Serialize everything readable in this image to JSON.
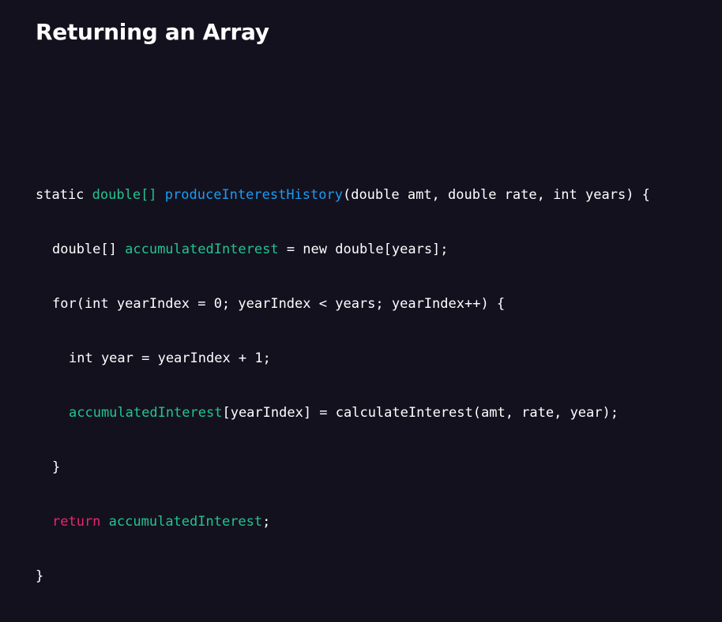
{
  "slide": {
    "title": "Returning an Array"
  },
  "colors": {
    "background": "#14111f",
    "default_text": "#ffffff",
    "type_green": "#21c58e",
    "method_blue": "#1a9df0",
    "keyword_pink": "#e8276b"
  },
  "code": {
    "lines": [
      {
        "indent": 0,
        "tokens": [
          {
            "text": "static ",
            "color": "default"
          },
          {
            "text": "double[]",
            "color": "green"
          },
          {
            "text": " ",
            "color": "default"
          },
          {
            "text": "produceInterestHistory",
            "color": "blue"
          },
          {
            "text": "(double amt, double rate, int years) {",
            "color": "default"
          }
        ]
      },
      {
        "indent": 1,
        "tokens": [
          {
            "text": "double[] ",
            "color": "default"
          },
          {
            "text": "accumulatedInterest",
            "color": "green"
          },
          {
            "text": " = new double[years];",
            "color": "default"
          }
        ]
      },
      {
        "indent": 1,
        "tokens": [
          {
            "text": "for(int yearIndex = 0; yearIndex < years; yearIndex++) {",
            "color": "default"
          }
        ]
      },
      {
        "indent": 2,
        "tokens": [
          {
            "text": "int year = yearIndex + 1;",
            "color": "default"
          }
        ]
      },
      {
        "indent": 2,
        "tokens": [
          {
            "text": "accumulatedInterest",
            "color": "green"
          },
          {
            "text": "[yearIndex] = calculateInterest(amt, rate, year);",
            "color": "default"
          }
        ]
      },
      {
        "indent": 1,
        "tokens": [
          {
            "text": "}",
            "color": "default"
          }
        ]
      },
      {
        "indent": 1,
        "tokens": [
          {
            "text": "return",
            "color": "pink"
          },
          {
            "text": " ",
            "color": "default"
          },
          {
            "text": "accumulatedInterest",
            "color": "green"
          },
          {
            "text": ";",
            "color": "default"
          }
        ]
      },
      {
        "indent": 0,
        "tokens": [
          {
            "text": "}",
            "color": "default"
          }
        ]
      }
    ]
  }
}
